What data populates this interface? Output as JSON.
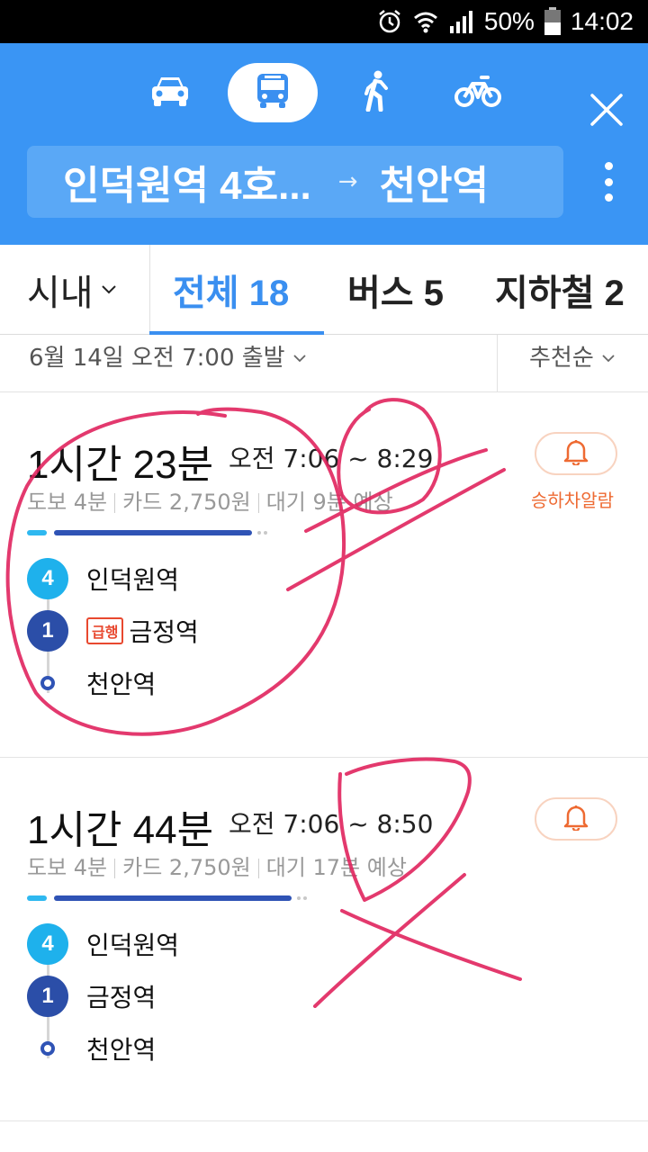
{
  "status_bar": {
    "battery": "50%",
    "time": "14:02",
    "icons": [
      "alarm-icon",
      "wifi-icon",
      "signal-icon",
      "battery-icon"
    ]
  },
  "header": {
    "modes": [
      {
        "name": "car",
        "icon": "car-icon",
        "selected": false
      },
      {
        "name": "transit",
        "icon": "bus-icon",
        "selected": true
      },
      {
        "name": "walk",
        "icon": "walk-icon",
        "selected": false
      },
      {
        "name": "bike",
        "icon": "bike-icon",
        "selected": false
      }
    ],
    "route_from": "인덕원역 4호...",
    "route_arrow": "→",
    "route_to": "천안역",
    "colors": {
      "bg": "#3a95f4",
      "route_box": "#5aa8f6"
    }
  },
  "tabs": {
    "area": "시내",
    "all": "전체 18",
    "bus": "버스 5",
    "subway": "지하철 2"
  },
  "filter": {
    "departure": "6월 14일 오전 7:00 출발",
    "sort": "추천순"
  },
  "routes": [
    {
      "duration": "1시간 23분",
      "time_range": "오전 7:06 ~ 8:29",
      "walk": "도보 4분",
      "fare": "카드 2,750원",
      "wait": "대기 9분 예상",
      "alarm_label": "승하차알람",
      "stops": [
        {
          "badge": "4",
          "line_color": "#1eb1ec",
          "name": "인덕원역",
          "tag": ""
        },
        {
          "badge": "1",
          "line_color": "#2b4ea8",
          "name": "금정역",
          "tag": "급행"
        },
        {
          "badge": "",
          "name": "천안역",
          "tag": ""
        }
      ]
    },
    {
      "duration": "1시간 44분",
      "time_range": "오전 7:06 ~ 8:50",
      "walk": "도보 4분",
      "fare": "카드 2,750원",
      "wait": "대기 17분 예상",
      "stops": [
        {
          "badge": "4",
          "line_color": "#1eb1ec",
          "name": "인덕원역",
          "tag": ""
        },
        {
          "badge": "1",
          "line_color": "#2b4ea8",
          "name": "금정역",
          "tag": ""
        },
        {
          "badge": "",
          "name": "천안역",
          "tag": ""
        }
      ]
    }
  ]
}
